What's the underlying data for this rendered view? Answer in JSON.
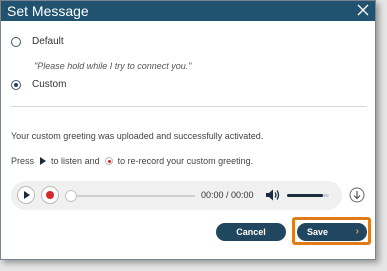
{
  "dialog": {
    "title": "Set Message",
    "options": [
      {
        "label": "Default",
        "checked": false
      },
      {
        "label": "Custom",
        "checked": true
      }
    ],
    "default_preview": "\"Please hold while I try to connect you.\"",
    "status_text": "Your custom greeting was uploaded and successfully activated.",
    "instructions": {
      "part1": "Press",
      "part2": "to listen and",
      "part3": "to re-record your custom greeting."
    },
    "player": {
      "time": "00:00 / 00:00",
      "volume_level": 0.85
    },
    "buttons": {
      "cancel": "Cancel",
      "save": "Save",
      "save_chevron": "›"
    }
  },
  "colors": {
    "titlebar": "#21526f",
    "button": "#21465f",
    "highlight": "#e07b1a",
    "record": "#d62828"
  },
  "icons": [
    "close-icon",
    "play-icon",
    "record-icon",
    "volume-icon",
    "download-icon",
    "chevron-right-icon"
  ]
}
